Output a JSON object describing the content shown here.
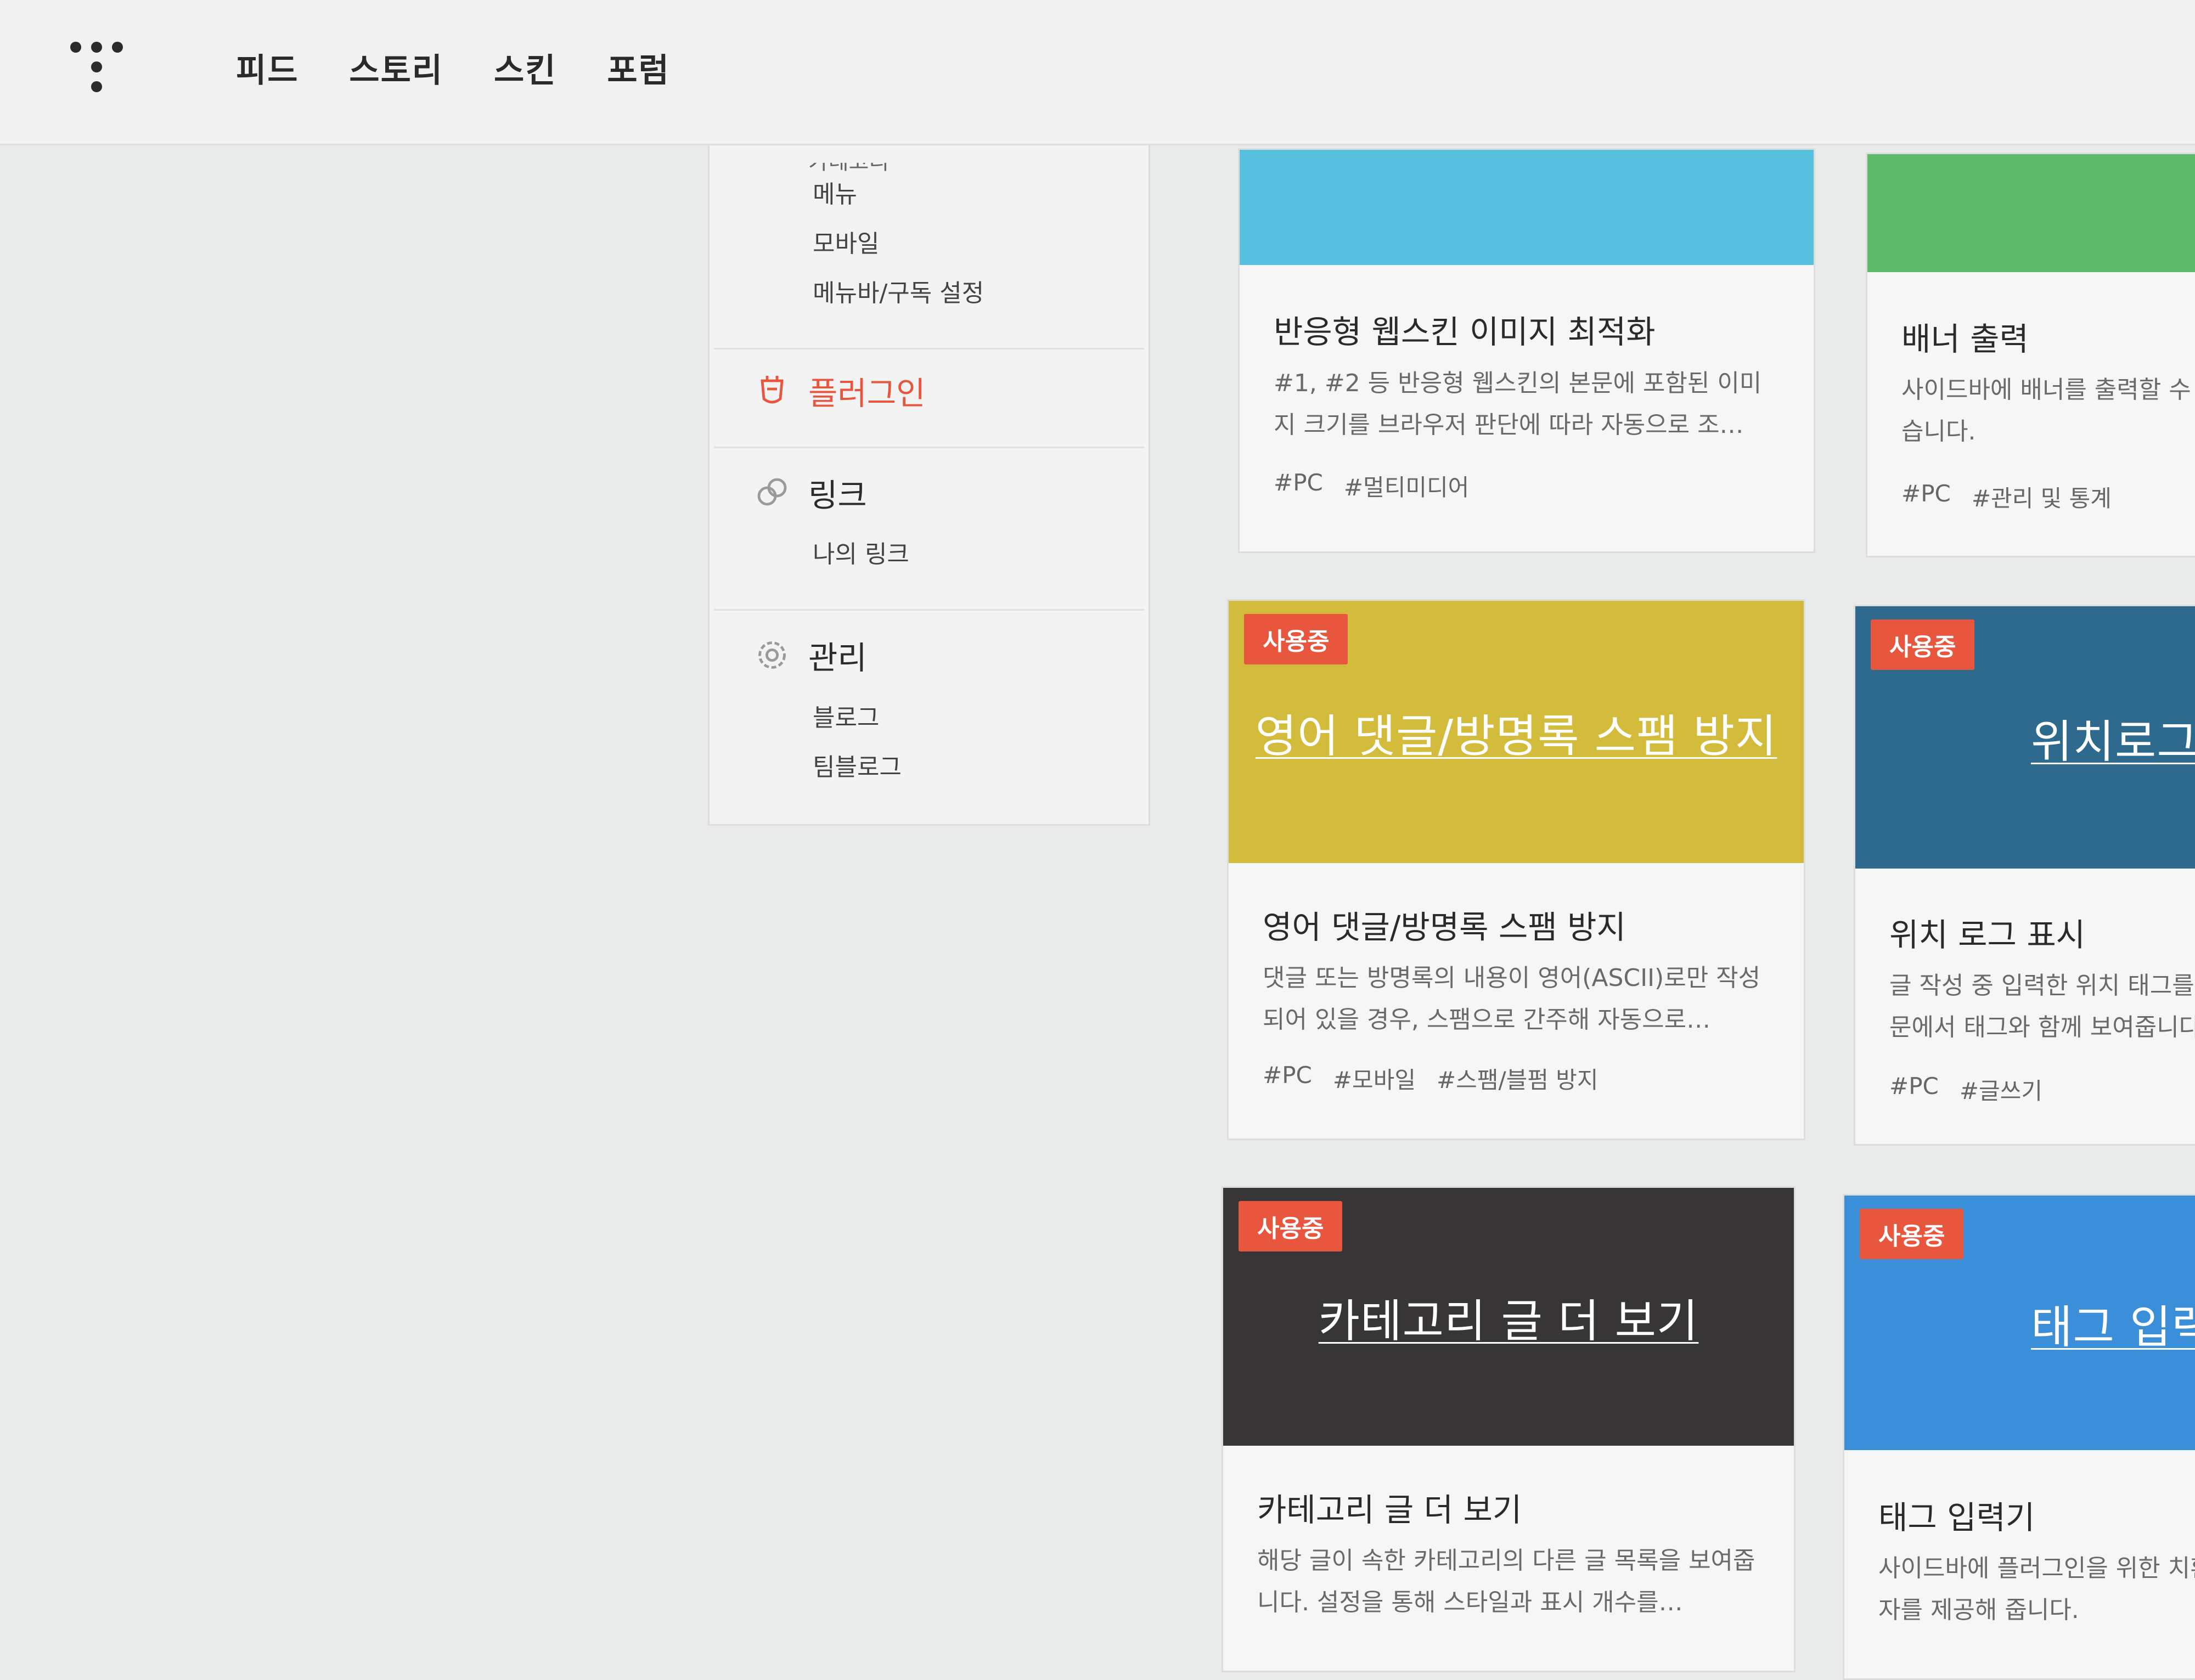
{
  "nav": {
    "items": [
      "피드",
      "스토리",
      "스킨",
      "포럼"
    ]
  },
  "sidebar": {
    "cut_label": "카테고리",
    "theme_items": [
      "메뉴",
      "모바일",
      "메뉴바/구독 설정"
    ],
    "plugin": {
      "label": "플러그인",
      "icon": "plugin-icon"
    },
    "link": {
      "label": "링크",
      "icon": "link-icon",
      "items": [
        "나의 링크"
      ]
    },
    "manage": {
      "label": "관리",
      "icon": "gear-icon",
      "items": [
        "블로그",
        "팀블로그"
      ]
    }
  },
  "colors": {
    "accent": "#e8563e",
    "thumb_cyan": "#56c1de",
    "thumb_green": "#5cba6a",
    "thumb_yellow": "#d3bb3c",
    "thumb_navy": "#2e6a8e",
    "thumb_dark": "#373536",
    "thumb_blue": "#3a8fd8"
  },
  "cards": [
    {
      "title": "반응형 웹스킨 이미지 최적화",
      "desc": "#1, #2 등 반응형 웹스킨의 본문에 포함된 이미지 크기를 브라우저 판단에 따라 자동으로 조…",
      "tags": [
        "#PC",
        "#멀티미디어"
      ]
    },
    {
      "title": "배너 출력",
      "desc": "사이드바에 배너를 출력할 수 있습니다.",
      "tags": [
        "#PC",
        "#관리 및 통계"
      ]
    },
    {
      "badge": "사용중",
      "thumb_title": "영어 댓글/방명록 스팸 방지",
      "title": "영어 댓글/방명록 스팸 방지",
      "desc": "댓글 또는 방명록의 내용이 영어(ASCII)로만 작성되어 있을 경우, 스팸으로 간주해 자동으로…",
      "tags": [
        "#PC",
        "#모바일",
        "#스팸/블펌 방지"
      ]
    },
    {
      "badge": "사용중",
      "thumb_title": "위치로그 표시",
      "title": "위치 로그 표시",
      "desc": "글 작성 중 입력한 위치 태그를 본문에서 태그와 함께 보여줍니다.",
      "tags": [
        "#PC",
        "#글쓰기"
      ]
    },
    {
      "badge": "사용중",
      "thumb_title": "카테고리 글 더 보기",
      "title": "카테고리 글 더 보기",
      "desc": "해당 글이 속한 카테고리의 다른 글 목록을 보여줍니다. 설정을 통해 스타일과 표시 개수를…",
      "tags": []
    },
    {
      "badge": "사용중",
      "thumb_title": "태그 입력기",
      "title": "태그 입력기",
      "desc": "사이드바에 플러그인을 위한 치환자를 제공해 줍니다.",
      "tags": []
    }
  ]
}
